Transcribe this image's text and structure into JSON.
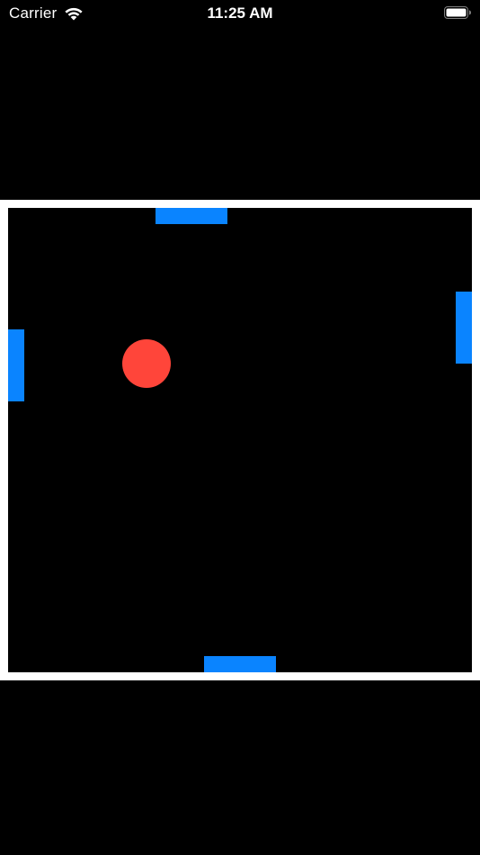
{
  "status_bar": {
    "carrier": "Carrier",
    "time": "11:25 AM",
    "wifi_icon": "wifi-icon",
    "battery_icon": "battery-full-icon"
  },
  "game": {
    "colors": {
      "background": "#000000",
      "board_border": "#ffffff",
      "paddle": "#0a84ff",
      "ball": "#ff453a"
    },
    "paddles": [
      "top",
      "bottom",
      "left",
      "right"
    ],
    "ball": "red-ball"
  }
}
